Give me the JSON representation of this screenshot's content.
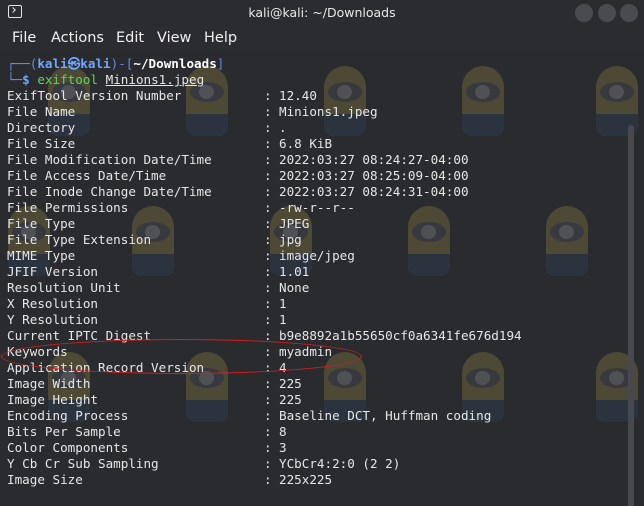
{
  "window": {
    "title": "kali@kali: ~/Downloads"
  },
  "menu": [
    "File",
    "Actions",
    "Edit",
    "View",
    "Help"
  ],
  "prompt": {
    "line1_prefix": "┌──(",
    "user": "kali",
    "host_symbol": "㉿",
    "host": "kali",
    "line1_mid": ")-[",
    "path": "~/Downloads",
    "line1_suffix": "]",
    "line2_prefix": "└─",
    "dollar": "$ ",
    "command": "exiftool",
    "argument": "Minions1.jpeg"
  },
  "exif": [
    {
      "key": "ExifTool Version Number",
      "value": "12.40"
    },
    {
      "key": "File Name",
      "value": "Minions1.jpeg"
    },
    {
      "key": "Directory",
      "value": "."
    },
    {
      "key": "File Size",
      "value": "6.8 KiB"
    },
    {
      "key": "File Modification Date/Time",
      "value": "2022:03:27 08:24:27-04:00"
    },
    {
      "key": "File Access Date/Time",
      "value": "2022:03:27 08:25:09-04:00"
    },
    {
      "key": "File Inode Change Date/Time",
      "value": "2022:03:27 08:24:31-04:00"
    },
    {
      "key": "File Permissions",
      "value": "-rw-r--r--"
    },
    {
      "key": "File Type",
      "value": "JPEG"
    },
    {
      "key": "File Type Extension",
      "value": "jpg"
    },
    {
      "key": "MIME Type",
      "value": "image/jpeg"
    },
    {
      "key": "JFIF Version",
      "value": "1.01"
    },
    {
      "key": "Resolution Unit",
      "value": "None"
    },
    {
      "key": "X Resolution",
      "value": "1"
    },
    {
      "key": "Y Resolution",
      "value": "1"
    },
    {
      "key": "Current IPTC Digest",
      "value": "b9e8892a1b55650cf0a6341fe676d194"
    },
    {
      "key": "Keywords",
      "value": "myadmin"
    },
    {
      "key": "Application Record Version",
      "value": "4"
    },
    {
      "key": "Image Width",
      "value": "225"
    },
    {
      "key": "Image Height",
      "value": "225"
    },
    {
      "key": "Encoding Process",
      "value": "Baseline DCT, Huffman coding"
    },
    {
      "key": "Bits Per Sample",
      "value": "8"
    },
    {
      "key": "Color Components",
      "value": "3"
    },
    {
      "key": "Y Cb Cr Sub Sampling",
      "value": "YCbCr4:2:0 (2 2)"
    },
    {
      "key": "Image Size",
      "value": "225x225"
    }
  ],
  "separator": ": ",
  "colors": {
    "titlebar": "#2b2c30",
    "terminal_bg": "#2a2b2f",
    "prompt_blue": "#6ea7ff",
    "command_green": "#58d858",
    "highlight_red": "#d21f1f",
    "text": "#e6e6e6"
  },
  "icons": [
    "terminal-icon",
    "minimize-button-icon",
    "maximize-button-icon",
    "close-button-icon"
  ]
}
